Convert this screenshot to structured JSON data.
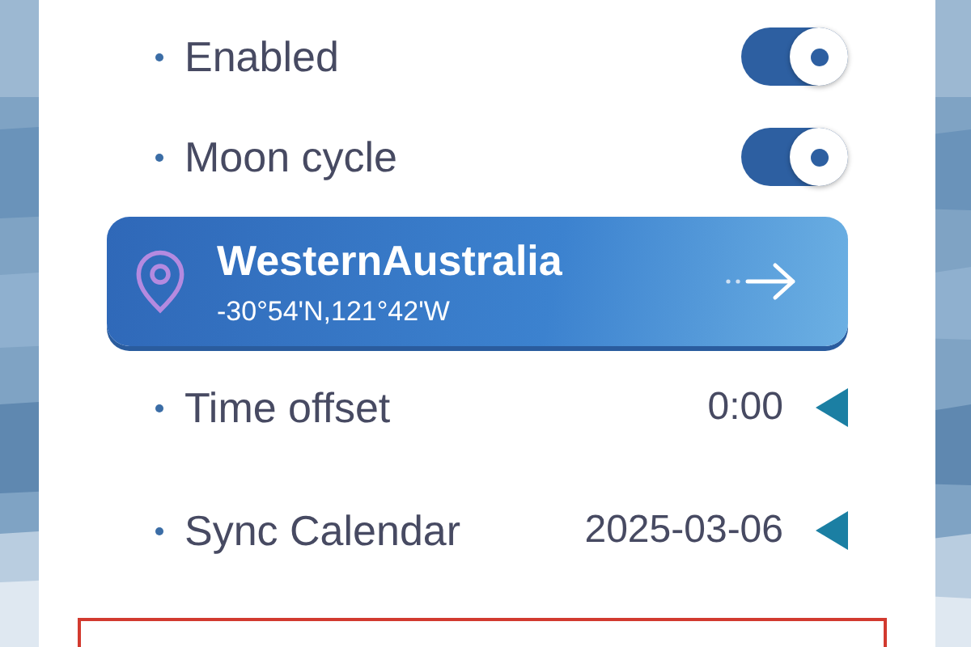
{
  "toggles": [
    {
      "label": "Enabled",
      "on": true
    },
    {
      "label": "Moon cycle",
      "on": true
    }
  ],
  "location": {
    "name": "WesternAustralia",
    "coordinates": "-30°54'N,121°42'W"
  },
  "pickers": [
    {
      "label": "Time offset",
      "value": "0:00"
    },
    {
      "label": "Sync Calendar",
      "value": "2025-03-06"
    }
  ]
}
